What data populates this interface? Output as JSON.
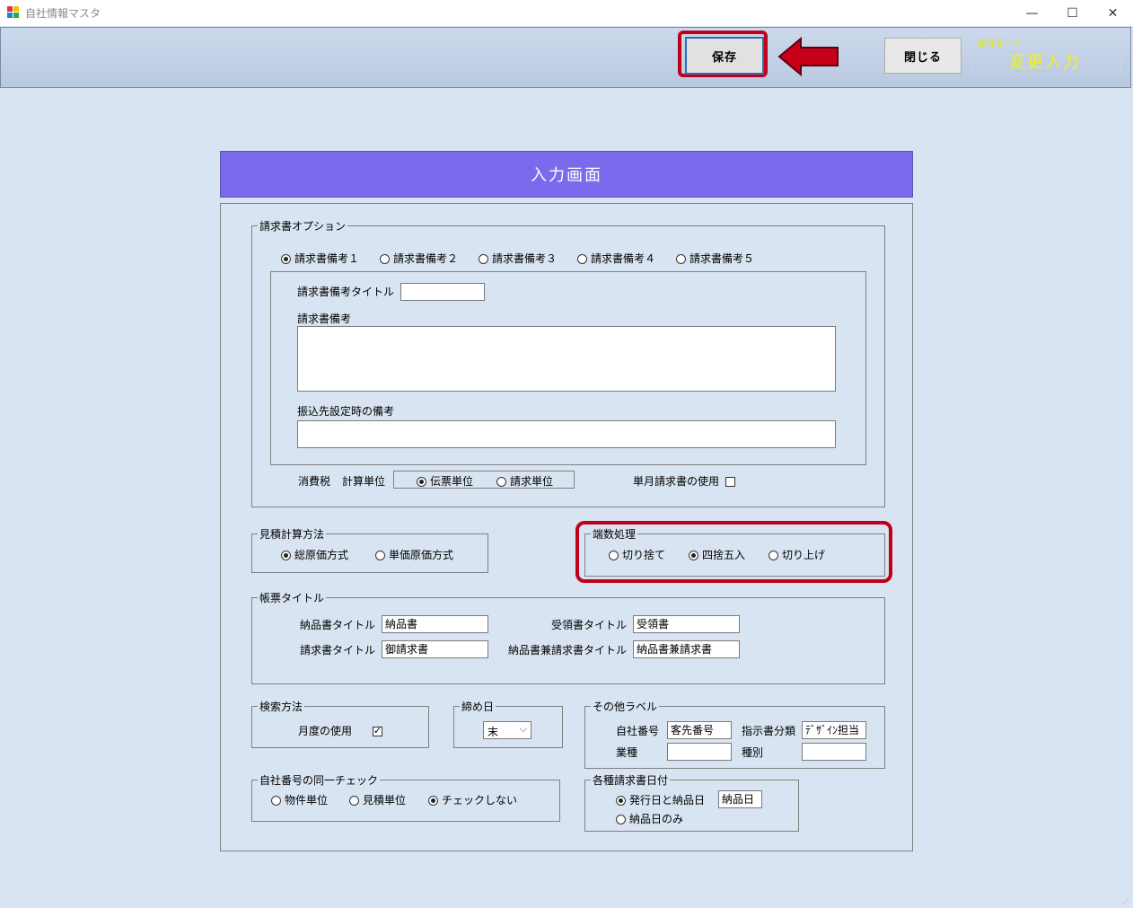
{
  "window": {
    "title": "自社情報マスタ",
    "minimize": "—",
    "maximize": "☐",
    "close": "✕"
  },
  "toolbar": {
    "save_label": "保存",
    "close_label": "閉じる",
    "mode_label": "実行モード",
    "mode_value": "変更入力"
  },
  "panel": {
    "header": "入力画面"
  },
  "invoice_options": {
    "legend": "請求書オプション",
    "tabs": [
      "請求書備考１",
      "請求書備考２",
      "請求書備考３",
      "請求書備考４",
      "請求書備考５"
    ],
    "selected_tab": 0,
    "remarks_title_label": "請求書備考タイトル",
    "remarks_title_value": "",
    "remarks_label": "請求書備考",
    "remarks_value": "",
    "transfer_remarks_label": "振込先設定時の備考",
    "transfer_remarks_value": "",
    "tax_label": "消費税",
    "calc_unit_label": "計算単位",
    "calc_unit_options": [
      "伝票単位",
      "請求単位"
    ],
    "calc_unit_selected": 0,
    "monthly_invoice_label": "単月請求書の使用",
    "monthly_invoice_checked": false
  },
  "estimate_method": {
    "legend": "見積計算方法",
    "options": [
      "総原価方式",
      "単価原価方式"
    ],
    "selected": 0
  },
  "rounding": {
    "legend": "端数処理",
    "options": [
      "切り捨て",
      "四捨五入",
      "切り上げ"
    ],
    "selected": 1
  },
  "form_titles": {
    "legend": "帳票タイトル",
    "delivery_label": "納品書タイトル",
    "delivery_value": "納品書",
    "receipt_label": "受領書タイトル",
    "receipt_value": "受領書",
    "invoice_label": "請求書タイトル",
    "invoice_value": "御請求書",
    "combined_label": "納品書兼請求書タイトル",
    "combined_value": "納品書兼請求書"
  },
  "search_method": {
    "legend": "検索方法",
    "month_label": "月度の使用",
    "month_checked": true
  },
  "closing_day": {
    "legend": "締め日",
    "value": "末"
  },
  "other_labels": {
    "legend": "その他ラベル",
    "company_no_label": "自社番号",
    "company_no_value": "客先番号",
    "instruction_label": "指示書分類",
    "instruction_value": "ﾃﾞｻﾞｲﾝ担当",
    "industry_label": "業種",
    "industry_value": "",
    "category_label": "種別",
    "category_value": ""
  },
  "duplicate_check": {
    "legend": "自社番号の同一チェック",
    "options": [
      "物件単位",
      "見積単位",
      "チェックしない"
    ],
    "selected": 2
  },
  "invoice_dates": {
    "legend": "各種請求書日付",
    "option1": "発行日と納品日",
    "option1_value": "納品日",
    "option2": "納品日のみ",
    "selected": 0
  }
}
